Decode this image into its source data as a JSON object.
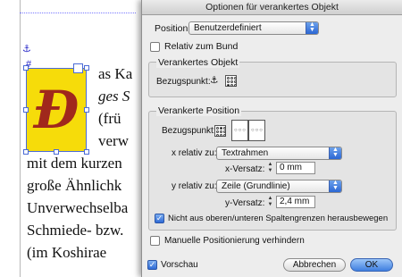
{
  "document": {
    "lines": [
      {
        "text": "as Ka",
        "italic": false
      },
      {
        "text": "ges S",
        "italic": true
      },
      {
        "text": "(frü",
        "italic": false
      },
      {
        "text": "verw",
        "italic": false
      },
      {
        "text": "mit dem kurzen",
        "italic": false
      },
      {
        "text": "große Ähnlichk",
        "italic": false
      },
      {
        "text": "Unverwechselba",
        "italic": false
      },
      {
        "text": "Schmiede- bzw.",
        "italic": false
      },
      {
        "text": "(im Koshirae",
        "italic": false
      }
    ],
    "initial_letter": "Ð",
    "frame_color": "#f6dc0a",
    "letter_color": "#a0281c"
  },
  "dialog": {
    "title": "Optionen für verankertes Objekt",
    "position_label": "Position:",
    "position_value": "Benutzerdefiniert",
    "relativ_bund_label": "Relativ zum Bund",
    "relativ_bund_checked": false,
    "anchored_object": {
      "heading": "Verankertes Objekt",
      "reference_label": "Bezugspunkt:"
    },
    "anchored_position": {
      "heading": "Verankerte Position",
      "reference_label": "Bezugspunkt:",
      "x_relative_label": "x relativ zu:",
      "x_relative_value": "Textrahmen",
      "x_offset_label": "x-Versatz:",
      "x_offset_value": "0 mm",
      "y_relative_label": "y relativ zu:",
      "y_relative_value": "Zeile (Grundlinie)",
      "y_offset_label": "y-Versatz:",
      "y_offset_value": "2,4 mm",
      "keep_within_label": "Nicht aus oberen/unteren Spaltengrenzen herausbewegen",
      "keep_within_checked": true
    },
    "manual_positioning_label": "Manuelle Positionierung verhindern",
    "manual_positioning_checked": false,
    "preview_label": "Vorschau",
    "preview_checked": true,
    "cancel_label": "Abbrechen",
    "ok_label": "OK",
    "accent_color": "#3f7fe0"
  }
}
